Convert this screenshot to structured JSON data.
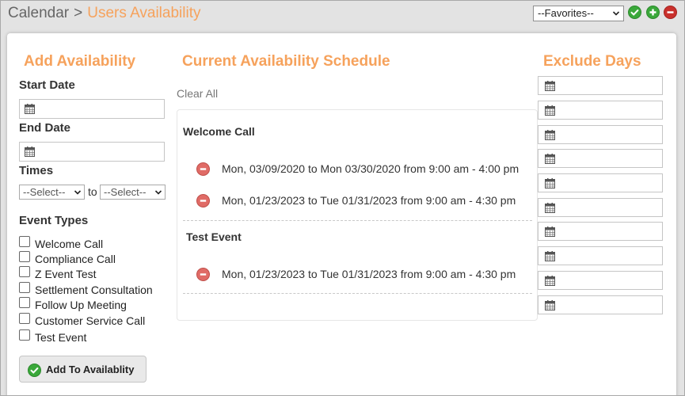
{
  "breadcrumb": {
    "root": "Calendar",
    "separator": ">",
    "current": "Users Availability"
  },
  "favorites": {
    "selected": "--Favorites--"
  },
  "icons": {
    "confirm": "check-circle-icon",
    "add": "plus-circle-icon",
    "remove": "minus-circle-icon",
    "date": "calendar-icon"
  },
  "colors": {
    "accent": "#f6a25c",
    "ok_green": "#3aa83a",
    "remove_red": "#c9302c"
  },
  "add_availability": {
    "title": "Add Availability",
    "start_date_label": "Start Date",
    "start_date_value": "",
    "end_date_label": "End Date",
    "end_date_value": "",
    "times_label": "Times",
    "time_from": "--Select--",
    "time_to_label": "to",
    "time_to": "--Select--",
    "event_types_label": "Event Types",
    "event_types": [
      {
        "label": "Welcome Call",
        "checked": false
      },
      {
        "label": "Compliance Call",
        "checked": false
      },
      {
        "label": "Z Event Test",
        "checked": false
      },
      {
        "label": "Settlement Consultation",
        "checked": false
      },
      {
        "label": "Follow Up Meeting",
        "checked": false
      },
      {
        "label": "Customer Service Call",
        "checked": false
      },
      {
        "label": "Test Event",
        "checked": false
      }
    ],
    "add_button": "Add To Availablity"
  },
  "schedule": {
    "title": "Current Availability Schedule",
    "clear_all": "Clear All",
    "groups": [
      {
        "name": "Welcome Call",
        "slots": [
          "Mon, 03/09/2020 to Mon 03/30/2020 from 9:00 am - 4:00 pm",
          "Mon, 01/23/2023 to Tue 01/31/2023 from 9:00 am - 4:30 pm"
        ]
      },
      {
        "name": "Test Event",
        "slots": [
          "Mon, 01/23/2023 to Tue 01/31/2023 from 9:00 am - 4:30 pm"
        ]
      }
    ]
  },
  "exclude_days": {
    "title": "Exclude Days",
    "dates": [
      "",
      "",
      "",
      "",
      "",
      "",
      "",
      "",
      "",
      ""
    ]
  }
}
